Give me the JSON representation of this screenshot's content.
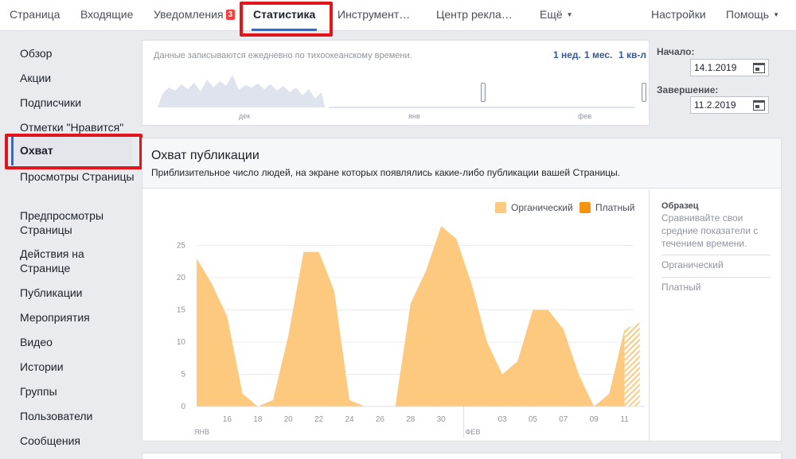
{
  "topnav": {
    "items": [
      {
        "label": "Страница"
      },
      {
        "label": "Входящие"
      },
      {
        "label": "Уведомления",
        "badge": "3"
      },
      {
        "label": "Статистика"
      },
      {
        "label": "Инструмент…"
      },
      {
        "label": "Центр рекла…"
      },
      {
        "label": "Ещё"
      }
    ],
    "settings": "Настройки",
    "help": "Помощь"
  },
  "sidebar": {
    "items": [
      "Обзор",
      "Акции",
      "Подписчики",
      "Отметки \"Нравится\"",
      "Охват",
      "Просмотры Страницы",
      "Предпросмотры Страницы",
      "Действия на Странице",
      "Публикации",
      "Мероприятия",
      "Видео",
      "Истории",
      "Группы",
      "Пользователи",
      "Сообщения"
    ],
    "active": "Охват"
  },
  "timeline": {
    "note": "Данные записываются ежедневно по тихоокеанскому времени.",
    "ranges": [
      "1 нед.",
      "1 мес.",
      "1 кв-л"
    ],
    "month_labels": [
      "дек",
      "янв",
      "фев"
    ],
    "start_label": "Начало:",
    "start_value": "14.1.2019",
    "end_label": "Завершение:",
    "end_value": "11.2.2019"
  },
  "reach": {
    "title": "Охват публикации",
    "subtitle": "Приблизительное число людей, на экране которых появлялись какие-либо публикации вашей Страницы.",
    "legend": {
      "organic": "Органический",
      "paid": "Платный"
    },
    "benchmark": {
      "title": "Образец",
      "desc": "Сравнивайте свои средние показатели с течением времени.",
      "items": [
        "Органический",
        "Платный"
      ]
    }
  },
  "colors": {
    "accent": "#4267b2",
    "organic": "#fdc97f",
    "paid": "#f5940f",
    "highlight": "#e3151a"
  },
  "chart_data": {
    "type": "area",
    "x": [
      "14 янв",
      "15",
      "16",
      "17",
      "18",
      "19",
      "20",
      "21",
      "22",
      "23",
      "24",
      "25",
      "26",
      "27",
      "28",
      "29",
      "30",
      "31",
      "1 фев",
      "2",
      "3",
      "4",
      "5",
      "6",
      "7",
      "8",
      "9",
      "10",
      "11"
    ],
    "x_tick_labels": [
      "16",
      "18",
      "20",
      "22",
      "24",
      "26",
      "28",
      "30",
      "03",
      "05",
      "07",
      "09",
      "11"
    ],
    "x_month_labels": [
      "ЯНВ",
      "ФЕВ"
    ],
    "series": [
      {
        "name": "Органический",
        "values": [
          23,
          19,
          14,
          2,
          0,
          1,
          11,
          24,
          24,
          18,
          1,
          0,
          0,
          0,
          16,
          21,
          28,
          26,
          19,
          10,
          5,
          7,
          15,
          15,
          12,
          5,
          0,
          2,
          12,
          13
        ]
      },
      {
        "name": "Платный",
        "values": []
      }
    ],
    "ylim": [
      0,
      28
    ],
    "yticks": [
      0,
      5,
      10,
      15,
      20,
      25
    ],
    "grid": true,
    "legend": "top-right"
  }
}
